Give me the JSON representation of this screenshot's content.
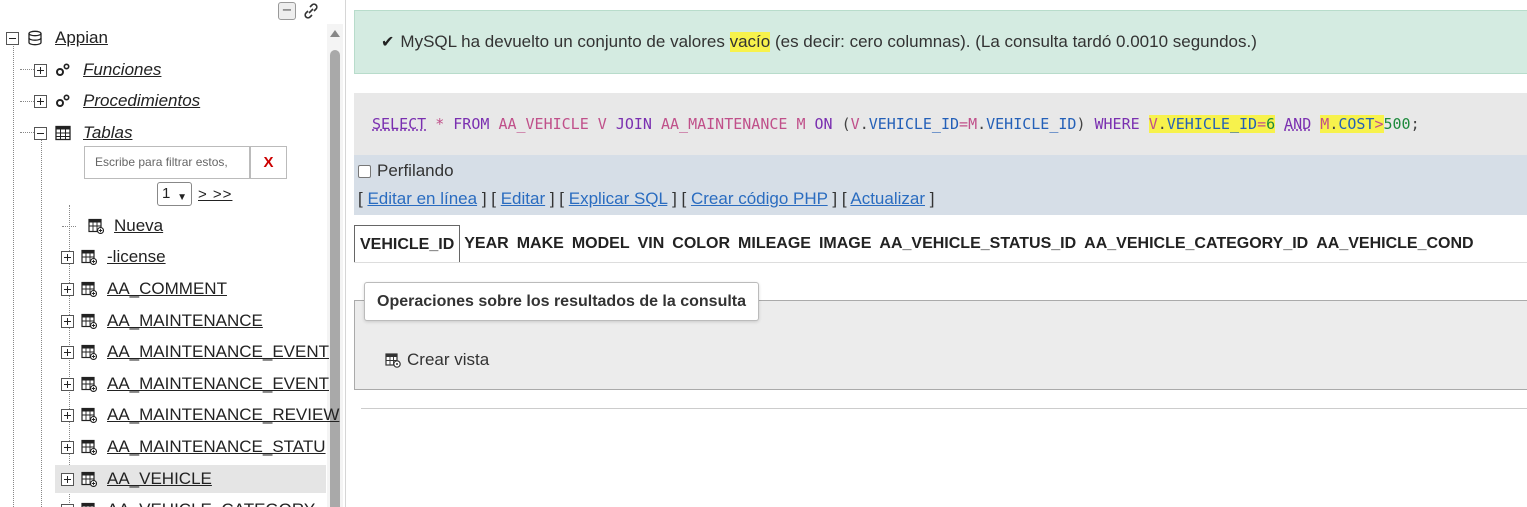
{
  "nav": {
    "collapse_symbol": "−",
    "root": {
      "label": "Appian",
      "icon": "database-icon"
    },
    "functions": {
      "label": "Funciones",
      "icon": "gears-icon"
    },
    "procedures": {
      "label": "Procedimientos",
      "icon": "gears-icon"
    },
    "tables": {
      "label": "Tablas",
      "icon": "table-icon"
    },
    "filter": {
      "placeholder": "Escribe para filtrar estos,",
      "clear_label": "X"
    },
    "pagination": {
      "selected_page": "1",
      "next_label": "> >>"
    },
    "items": [
      {
        "label": "Nueva"
      },
      {
        "label": "-license"
      },
      {
        "label": "AA_COMMENT"
      },
      {
        "label": "AA_MAINTENANCE"
      },
      {
        "label": "AA_MAINTENANCE_EVENT"
      },
      {
        "label": "AA_MAINTENANCE_EVENT"
      },
      {
        "label": "AA_MAINTENANCE_REVIEW"
      },
      {
        "label": "AA_MAINTENANCE_STATU"
      },
      {
        "label": "AA_VEHICLE"
      },
      {
        "label": "AA_VEHICLE_CATEGORY"
      }
    ]
  },
  "message": {
    "icon": "check-icon",
    "before": "MySQL ha devuelto un conjunto de valores ",
    "highlight": "vacío",
    "after": " (es decir: cero columnas). (La consulta tardó 0.0010 segundos.)"
  },
  "sql": {
    "t1": "SELECT",
    "t2": "*",
    "t3": "FROM",
    "t4": "AA_VEHICLE",
    "t5": "V",
    "t6": "JOIN",
    "t7": "AA_MAINTENANCE",
    "t8": "M",
    "t9": "ON",
    "t10": "(",
    "t11": "V",
    "t12": ".",
    "t13": "VEHICLE_ID",
    "t14": "=",
    "t15": "M",
    "t16": ".",
    "t17": "VEHICLE_ID",
    "t18": ")",
    "t19": "WHERE",
    "t20": "V",
    "t21": ".",
    "t22": "VEHICLE_ID",
    "t23": "=",
    "t24": "6",
    "t25": "AND",
    "t26": "M",
    "t27": ".",
    "t28": "COST",
    "t29": ">",
    "t30": "500",
    "t31": ";"
  },
  "profiling": {
    "label": "Perfilando",
    "checked": false
  },
  "actions": {
    "inline_edit": "Editar en línea",
    "edit": "Editar",
    "explain": "Explicar SQL",
    "php": "Crear código PHP",
    "refresh": "Actualizar"
  },
  "columns": [
    "VEHICLE_ID",
    "YEAR",
    "MAKE",
    "MODEL",
    "VIN",
    "COLOR",
    "MILEAGE",
    "IMAGE",
    "AA_VEHICLE_STATUS_ID",
    "AA_VEHICLE_CATEGORY_ID",
    "AA_VEHICLE_COND"
  ],
  "operations": {
    "legend": "Operaciones sobre los resultados de la consulta",
    "create_view": "Crear vista",
    "create_view_icon": "view-icon"
  },
  "colors": {
    "success_bg": "#d4ebe1",
    "highlight": "#f7f24c",
    "link": "#2a6cc0",
    "keyword": "#7a2fb0",
    "table_name": "#c0508a",
    "column_name": "#2460b8"
  }
}
